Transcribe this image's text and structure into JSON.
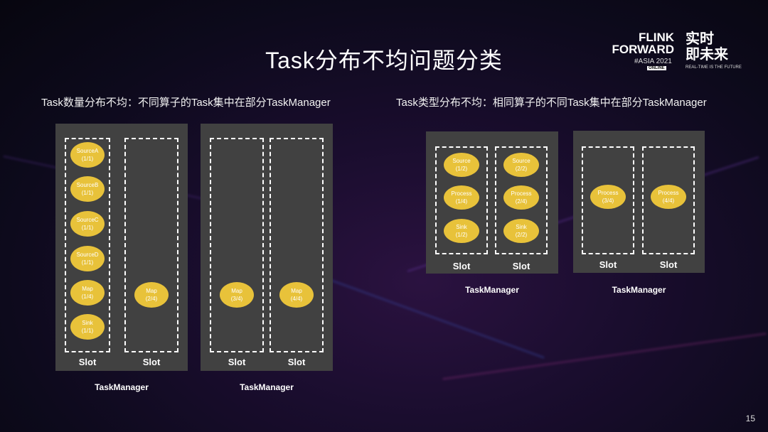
{
  "slide": {
    "title": "Task分布不均问题分类",
    "page_number": "15"
  },
  "logo": {
    "line1": "FLINK",
    "line2": "FORWARD",
    "event": "#ASIA 2021",
    "badge": "ONLINE",
    "cn_line1": "实时",
    "cn_line2": "即未来",
    "tagline": "REAL-TIME IS THE FUTURE"
  },
  "left": {
    "subtitle": "Task数量分布不均：不同算子的Task集中在部分TaskManager",
    "taskmanagers": [
      {
        "label": "TaskManager",
        "slots": [
          {
            "label": "Slot",
            "ops": [
              [
                "SourceA",
                "(1/1)"
              ],
              [
                "SourceB",
                "(1/1)"
              ],
              [
                "SourceC",
                "(1/1)"
              ],
              [
                "SourceD",
                "(1/1)"
              ],
              [
                "Map",
                "(1/4)"
              ],
              [
                "Sink",
                "(1/1)"
              ]
            ]
          },
          {
            "label": "Slot",
            "ops": [
              [
                "Map",
                "(2/4)"
              ]
            ]
          }
        ]
      },
      {
        "label": "TaskManager",
        "slots": [
          {
            "label": "Slot",
            "ops": [
              [
                "Map",
                "(3/4)"
              ]
            ]
          },
          {
            "label": "Slot",
            "ops": [
              [
                "Map",
                "(4/4)"
              ]
            ]
          }
        ]
      }
    ]
  },
  "right": {
    "subtitle": "Task类型分布不均：相同算子的不同Task集中在部分TaskManager",
    "taskmanagers": [
      {
        "label": "TaskManager",
        "slots": [
          {
            "label": "Slot",
            "ops": [
              [
                "Source",
                "(1/2)"
              ],
              [
                "Process",
                "(1/4)"
              ],
              [
                "Sink",
                "(1/2)"
              ]
            ]
          },
          {
            "label": "Slot",
            "ops": [
              [
                "Source",
                "(2/2)"
              ],
              [
                "Process",
                "(2/4)"
              ],
              [
                "Sink",
                "(2/2)"
              ]
            ]
          }
        ]
      },
      {
        "label": "TaskManager",
        "slots": [
          {
            "label": "Slot",
            "ops": [
              [
                "Process",
                "(3/4)"
              ]
            ]
          },
          {
            "label": "Slot",
            "ops": [
              [
                "Process",
                "(4/4)"
              ]
            ]
          }
        ]
      }
    ]
  }
}
